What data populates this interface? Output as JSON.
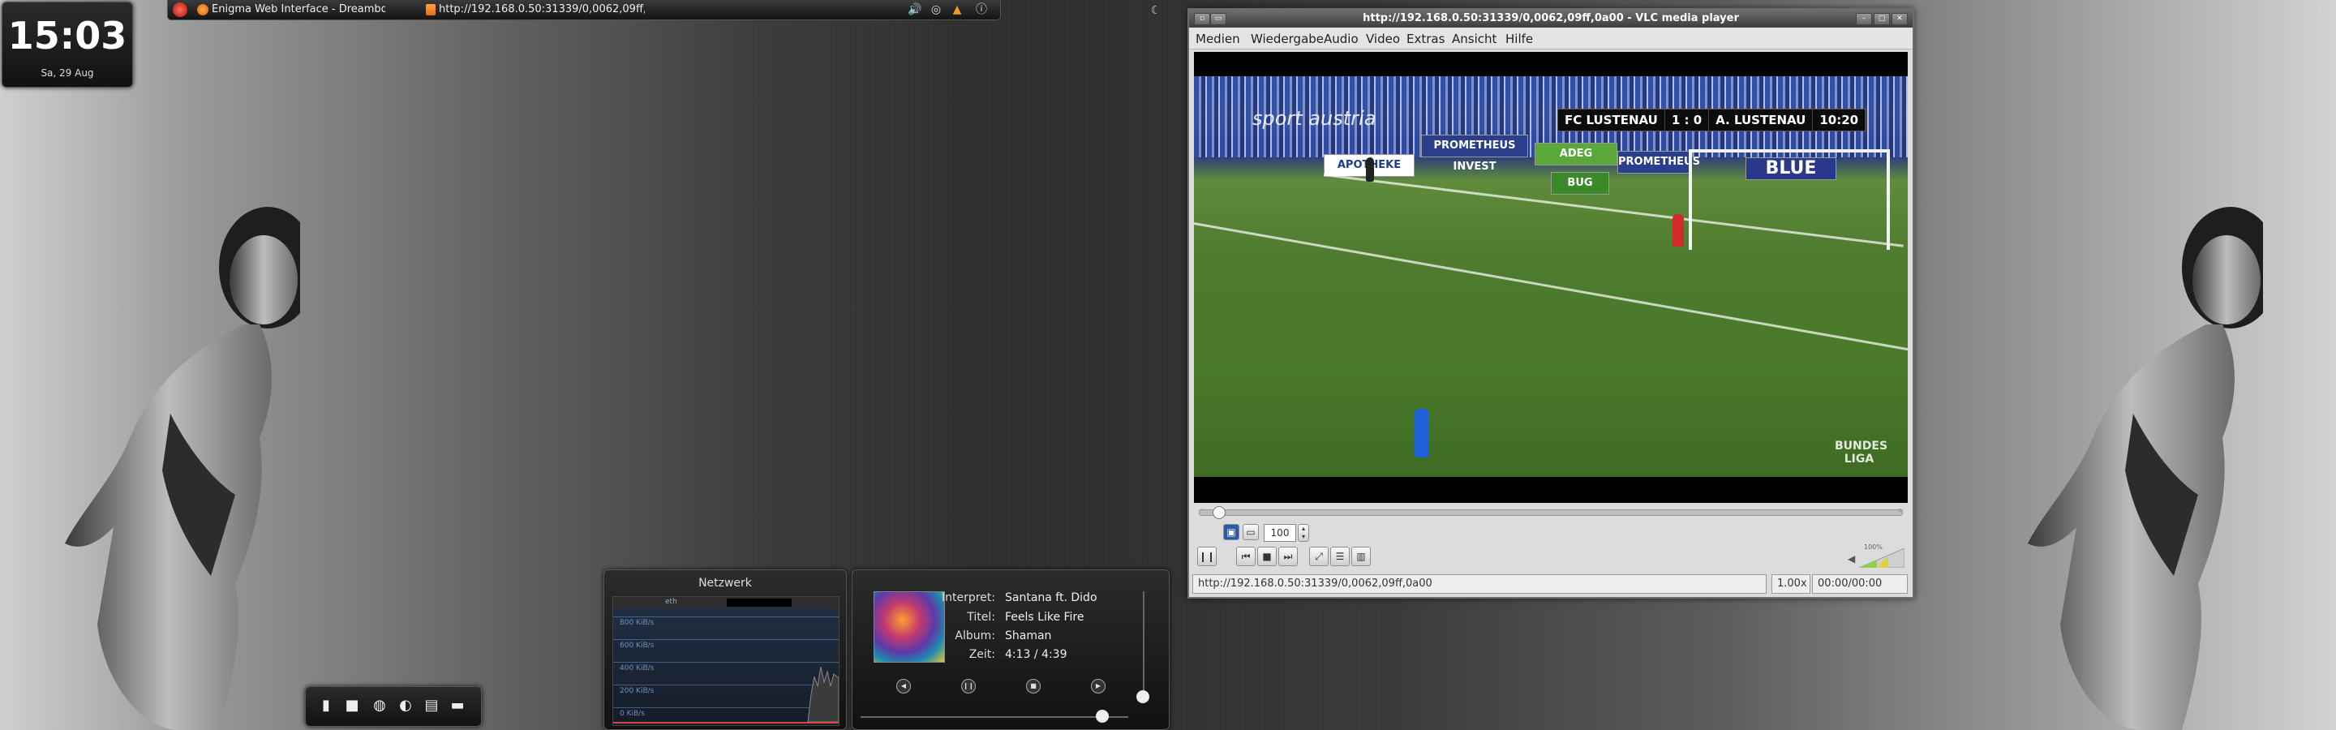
{
  "clock": {
    "time": "15:03",
    "date": "Sa, 29 Aug"
  },
  "taskbar": {
    "tasks": [
      {
        "label": "Enigma Web Interface - Dreambox - M..."
      },
      {
        "label": "http://192.168.0.50:31339/0,0062,09ff,0..."
      }
    ]
  },
  "vlc": {
    "title": "http://192.168.0.50:31339/0,0062,09ff,0a00 - VLC media player",
    "menu": [
      "Medien",
      "Wiedergabe",
      "Audio",
      "Video",
      "Extras",
      "Ansicht",
      "Hilfe"
    ],
    "video": {
      "score": {
        "home": "FC LUSTENAU",
        "result": "1 : 0",
        "away": "A. LUSTENAU",
        "clock": "10:20"
      },
      "channel": "sport austria",
      "ads": [
        "PROMETHEUS INVEST",
        "ADEG",
        "PROMETHEUS",
        "BLUE",
        "BUG",
        "APOTHEKE"
      ],
      "logo": "BUNDES LIGA"
    },
    "zoom_value": "100",
    "status": {
      "url": "http://192.168.0.50:31339/0,0062,09ff,0a00",
      "rate": "1.00x",
      "time": "00:00/00:00"
    },
    "volume_label": "100%"
  },
  "net_widget": {
    "title": "Netzwerk",
    "tab": "eth",
    "labels": [
      "800 KiB/s",
      "600 KiB/s",
      "400 KiB/s",
      "200 KiB/s",
      "0 KiB/s"
    ]
  },
  "music_widget": {
    "interpreter_label": "Interpret:",
    "interpreter": "Santana ft. Dido",
    "title_label": "Titel:",
    "title": "Feels Like Fire",
    "album_label": "Album:",
    "album": "Shaman",
    "time_label": "Zeit:",
    "time": "4:13 / 4:39"
  }
}
